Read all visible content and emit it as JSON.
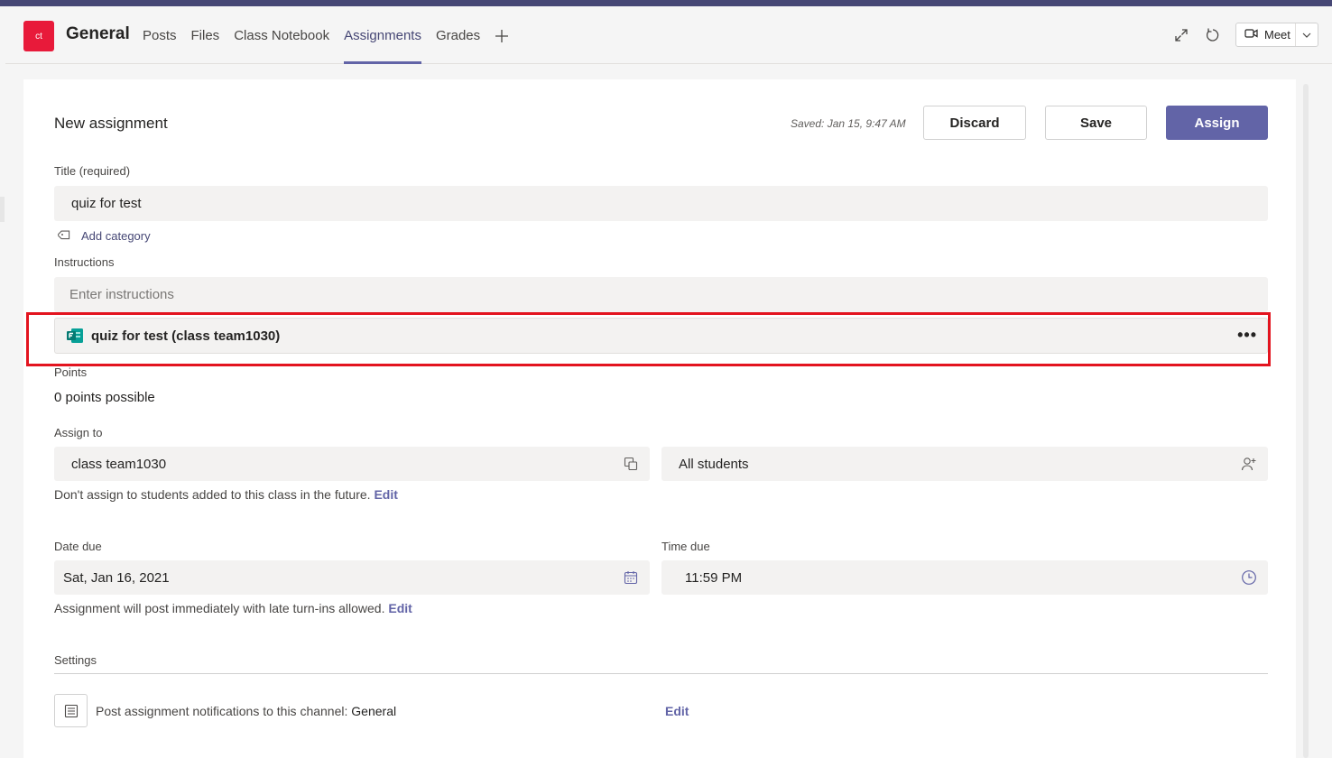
{
  "header": {
    "team_initials": "ct",
    "channel_name": "General",
    "tabs": [
      {
        "label": "Posts"
      },
      {
        "label": "Files"
      },
      {
        "label": "Class Notebook"
      },
      {
        "label": "Assignments",
        "active": true
      },
      {
        "label": "Grades"
      }
    ],
    "add_tab_icon": "plus-icon",
    "meet_label": "Meet"
  },
  "form": {
    "heading": "New assignment",
    "saved_status": "Saved: Jan 15, 9:47 AM",
    "discard_label": "Discard",
    "save_label": "Save",
    "assign_label": "Assign",
    "title_label": "Title (required)",
    "title_value": "quiz for test",
    "add_category_label": "Add category",
    "instructions_label": "Instructions",
    "instructions_placeholder": "Enter instructions",
    "attachment": {
      "name": "quiz for test (class team1030)",
      "icon": "forms-icon",
      "more_icon": "•••"
    },
    "points_label": "Points",
    "points_value": "0 points possible",
    "assign_to_label": "Assign to",
    "assign_class_value": "class team1030",
    "assign_students_value": "All students",
    "future_students_text": "Don't assign to students added to this class in the future.",
    "future_students_edit": "Edit",
    "date_due_label": "Date due",
    "date_due_value": "Sat, Jan 16, 2021",
    "time_due_label": "Time due",
    "time_due_value": "11:59 PM",
    "post_text": "Assignment will post immediately with late turn-ins allowed.",
    "post_edit": "Edit",
    "settings_label": "Settings",
    "notification_text": "Post assignment notifications to this channel:",
    "notification_channel": "General",
    "notification_edit": "Edit"
  },
  "colors": {
    "accent": "#6264a7",
    "team_avatar": "#e81a3a",
    "highlight_border": "#e3141f"
  }
}
